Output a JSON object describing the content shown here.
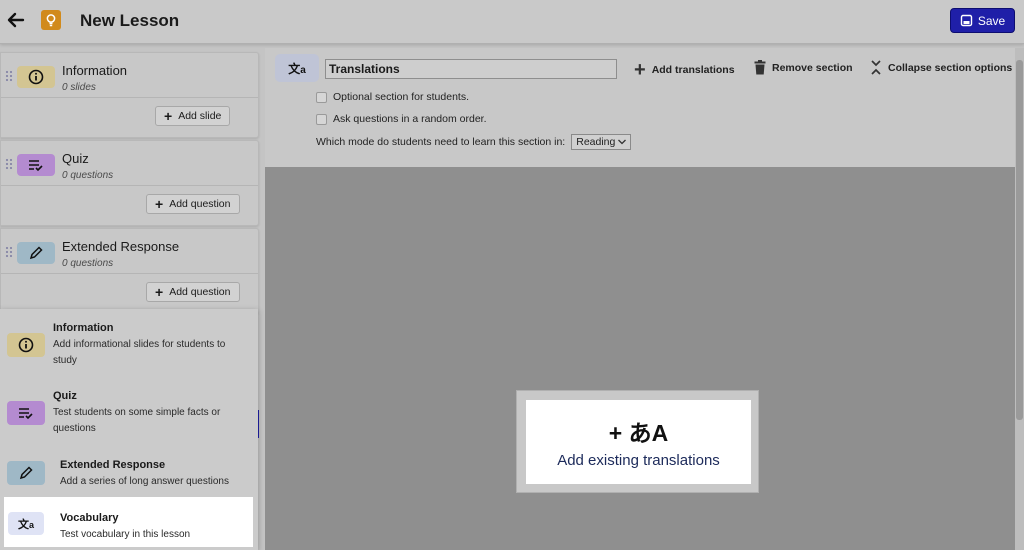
{
  "header": {
    "title": "New Lesson",
    "save_label": "Save"
  },
  "sections": [
    {
      "title": "Information",
      "count": "0 slides",
      "add_label": "Add slide",
      "icon": "info-icon",
      "color": "#d3c592"
    },
    {
      "title": "Quiz",
      "count": "0 questions",
      "add_label": "Add question",
      "icon": "quiz-list-icon",
      "color": "#b48bd0"
    },
    {
      "title": "Extended Response",
      "count": "0 questions",
      "add_label": "Add question",
      "icon": "pencil-icon",
      "color": "#9fb8c6"
    }
  ],
  "menu": {
    "items": [
      {
        "title": "Information",
        "desc": "Add informational slides for students to study",
        "icon": "info-icon",
        "color": "#d3c592"
      },
      {
        "title": "Quiz",
        "desc": "Test students on some simple facts or questions",
        "icon": "quiz-list-icon",
        "color": "#b48bd0"
      },
      {
        "title": "Extended Response",
        "desc": "Add a series of long answer questions",
        "icon": "pencil-icon",
        "color": "#9fb8c6"
      },
      {
        "title": "Vocabulary",
        "desc": "Test vocabulary in this lesson",
        "icon": "translate-icon",
        "color": "#dfe3f5"
      }
    ]
  },
  "translations_panel": {
    "name_value": "Translations",
    "add_translations_label": "Add translations",
    "remove_section_label": "Remove section",
    "collapse_label": "Collapse section options",
    "optional_label": "Optional section for students.",
    "random_order_label": "Ask questions in a random order.",
    "mode_question": "Which mode do students need to learn this section in:",
    "mode_value": "Reading"
  },
  "add_existing": {
    "glyph": "+ あA",
    "label": "Add existing translations"
  }
}
